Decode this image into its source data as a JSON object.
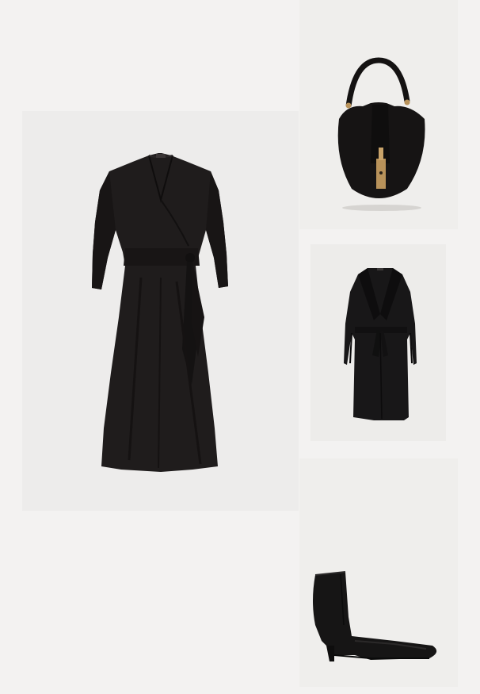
{
  "outfit": {
    "items": [
      {
        "id": "dress",
        "kind": "wrap-dress",
        "color": "#1e1b1b",
        "icon": "dress-image"
      },
      {
        "id": "bag",
        "kind": "shoulder-bag",
        "color": "#151313",
        "accent": "#b8925a",
        "icon": "handbag-image"
      },
      {
        "id": "coat",
        "kind": "belted-wrap-coat",
        "color": "#171617",
        "icon": "coat-image"
      },
      {
        "id": "boot",
        "kind": "ankle-boot",
        "color": "#151414",
        "icon": "boot-image"
      }
    ]
  },
  "colors": {
    "page_background": "#f3f2f1",
    "tile_background": "#edeceb"
  }
}
